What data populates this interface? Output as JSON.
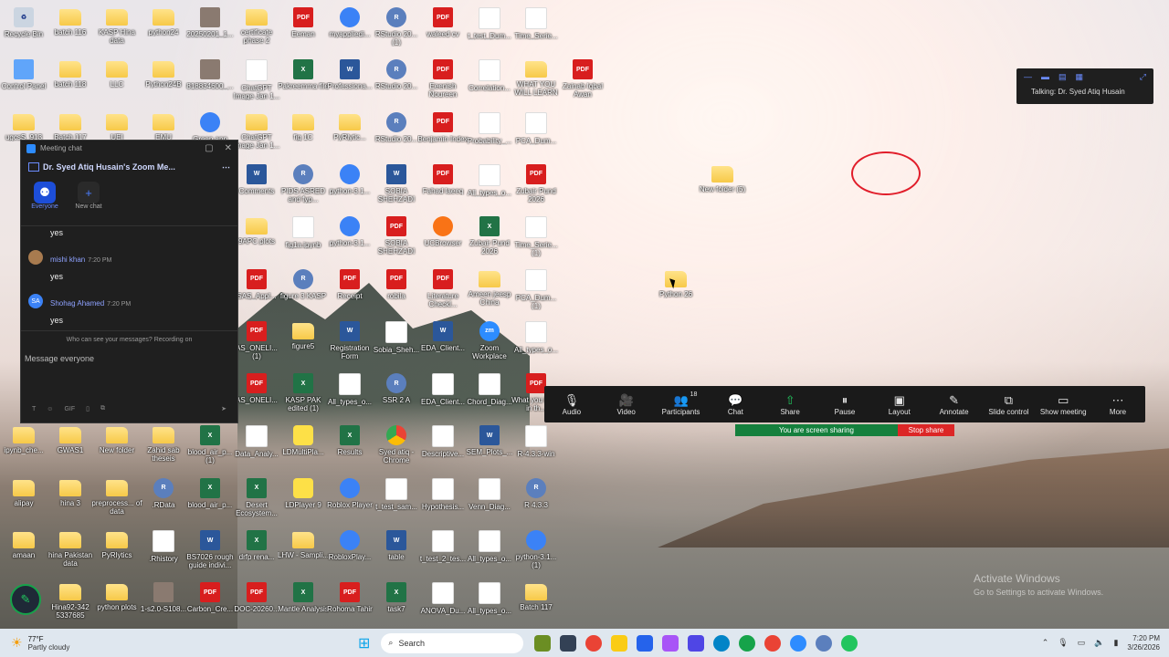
{
  "desktop_icons": [
    {
      "label": "Recycle Bin",
      "type": "recycle",
      "col": 0,
      "row": 0
    },
    {
      "label": "batch 116",
      "type": "folder",
      "col": 1,
      "row": 0
    },
    {
      "label": "KASP Hina data",
      "type": "folder",
      "col": 2,
      "row": 0
    },
    {
      "label": "python24",
      "type": "folder",
      "col": 3,
      "row": 0
    },
    {
      "label": "20250201_1...",
      "type": "img",
      "col": 4,
      "row": 0
    },
    {
      "label": "certificate phase 2",
      "type": "folder",
      "col": 5,
      "row": 0
    },
    {
      "label": "Eeman",
      "type": "pdf",
      "col": 6,
      "row": 0
    },
    {
      "label": "myappliedi...",
      "type": "app",
      "col": 7,
      "row": 0
    },
    {
      "label": "RStudio 20... (1)",
      "type": "r",
      "col": 8,
      "row": 0
    },
    {
      "label": "waleed cv",
      "type": "pdf",
      "col": 9,
      "row": 0
    },
    {
      "label": "t_test_Dum...",
      "type": "file",
      "col": 10,
      "row": 0
    },
    {
      "label": "Time_Serie...",
      "type": "file",
      "col": 11,
      "row": 0
    },
    {
      "label": "Control Panel",
      "type": "cp",
      "col": 0,
      "row": 1
    },
    {
      "label": "batch 118",
      "type": "folder",
      "col": 1,
      "row": 1
    },
    {
      "label": "LLC",
      "type": "folder",
      "col": 2,
      "row": 1
    },
    {
      "label": "Python24B",
      "type": "folder",
      "col": 3,
      "row": 1
    },
    {
      "label": "818834600_...",
      "type": "img",
      "col": 4,
      "row": 1
    },
    {
      "label": "ChatGPT Image Jan 1...",
      "type": "file",
      "col": 5,
      "row": 1
    },
    {
      "label": "Pakreemma file",
      "type": "excel",
      "col": 6,
      "row": 1
    },
    {
      "label": "Professiona...",
      "type": "word",
      "col": 7,
      "row": 1
    },
    {
      "label": "RStudio 20...",
      "type": "r",
      "col": 8,
      "row": 1
    },
    {
      "label": "Eeenish Noureen",
      "type": "pdf",
      "col": 9,
      "row": 1
    },
    {
      "label": "Correlation...",
      "type": "file",
      "col": 10,
      "row": 1
    },
    {
      "label": "WHAT YOU WILL LEARN",
      "type": "folder",
      "col": 11,
      "row": 1
    },
    {
      "label": "Zainab Iqbal Awan",
      "type": "pdf",
      "col": 12,
      "row": 1
    },
    {
      "label": "ugcsS_913",
      "type": "folder",
      "col": 0,
      "row": 2
    },
    {
      "label": "Batch 117",
      "type": "folder",
      "col": 1,
      "row": 2
    },
    {
      "label": "UEI",
      "type": "folder",
      "col": 2,
      "row": 2
    },
    {
      "label": "EMU",
      "type": "folder",
      "col": 3,
      "row": 2
    },
    {
      "label": "Green app",
      "type": "app",
      "col": 4,
      "row": 2
    },
    {
      "label": "ChatGPT Image Jan 1...",
      "type": "folder",
      "col": 5,
      "row": 2
    },
    {
      "label": "fig 1C",
      "type": "folder",
      "col": 6,
      "row": 2
    },
    {
      "label": "PyRlytic...",
      "type": "folder",
      "col": 7,
      "row": 2
    },
    {
      "label": "RStudio 20...",
      "type": "r",
      "col": 8,
      "row": 2
    },
    {
      "label": "Benjamin Index",
      "type": "pdf",
      "col": 9,
      "row": 2
    },
    {
      "label": "Probability_...",
      "type": "file",
      "col": 10,
      "row": 2
    },
    {
      "label": "PCA_Dum...",
      "type": "file",
      "col": 11,
      "row": 2
    },
    {
      "label": "Comments",
      "type": "word",
      "col": 5,
      "row": 3
    },
    {
      "label": "PIDS ASRED and fyp...",
      "type": "r",
      "col": 6,
      "row": 3
    },
    {
      "label": "python-3.1...",
      "type": "app",
      "col": 7,
      "row": 3
    },
    {
      "label": "SOBIA SHEHZADI",
      "type": "word",
      "col": 8,
      "row": 3
    },
    {
      "label": "Fahad laeeq",
      "type": "pdf",
      "col": 9,
      "row": 3
    },
    {
      "label": "All_types_o...",
      "type": "file",
      "col": 10,
      "row": 3
    },
    {
      "label": "Zubair Pund 2026",
      "type": "pdf",
      "col": 11,
      "row": 3
    },
    {
      "label": "New folder (5)",
      "type": "folder",
      "col": 15,
      "row": 3
    },
    {
      "label": "9APC plots",
      "type": "folder",
      "col": 5,
      "row": 4
    },
    {
      "label": "fig1a.ipynb",
      "type": "file",
      "col": 6,
      "row": 4
    },
    {
      "label": "python-3.1...",
      "type": "app",
      "col": 7,
      "row": 4
    },
    {
      "label": "SOBIA SHEHZADI",
      "type": "pdf",
      "col": 8,
      "row": 4
    },
    {
      "label": "UCBrowser",
      "type": "orange",
      "col": 9,
      "row": 4
    },
    {
      "label": "Zubair Pund 2026",
      "type": "excel",
      "col": 10,
      "row": 4
    },
    {
      "label": "Time_Serie... (1)",
      "type": "file",
      "col": 11,
      "row": 4
    },
    {
      "label": "SAS_Appl...",
      "type": "pdf",
      "col": 5,
      "row": 5
    },
    {
      "label": "figure 3 KASP",
      "type": "r",
      "col": 6,
      "row": 5
    },
    {
      "label": "Receipt",
      "type": "pdf",
      "col": 7,
      "row": 5
    },
    {
      "label": "robila",
      "type": "pdf",
      "col": 8,
      "row": 5
    },
    {
      "label": "Literature Checkl...",
      "type": "pdf",
      "col": 9,
      "row": 5
    },
    {
      "label": "Ameen jeesp China",
      "type": "folder",
      "col": 10,
      "row": 5
    },
    {
      "label": "PCA_Dum... (1)",
      "type": "file",
      "col": 11,
      "row": 5
    },
    {
      "label": "Python 26",
      "type": "folder",
      "col": 14,
      "row": 5
    },
    {
      "label": "AS_ONELI... (1)",
      "type": "pdf",
      "col": 5,
      "row": 6
    },
    {
      "label": "figure5",
      "type": "folder",
      "col": 6,
      "row": 6
    },
    {
      "label": "Registration Form",
      "type": "word",
      "col": 7,
      "row": 6
    },
    {
      "label": "Sobia_Sheh...",
      "type": "file",
      "col": 8,
      "row": 6
    },
    {
      "label": "EDA_Client...",
      "type": "word",
      "col": 9,
      "row": 6
    },
    {
      "label": "Zoom Workplace",
      "type": "zoom",
      "col": 10,
      "row": 6
    },
    {
      "label": "All_types_o...",
      "type": "file",
      "col": 11,
      "row": 6
    },
    {
      "label": "AS_ONELI...",
      "type": "pdf",
      "col": 5,
      "row": 7
    },
    {
      "label": "KASP PAK edited (1)",
      "type": "excel",
      "col": 6,
      "row": 7
    },
    {
      "label": "All_types_o...",
      "type": "file",
      "col": 7,
      "row": 7
    },
    {
      "label": "SSR 2 A",
      "type": "r",
      "col": 8,
      "row": 7
    },
    {
      "label": "EDA_Client...",
      "type": "file",
      "col": 9,
      "row": 7
    },
    {
      "label": "Chord_Diag...",
      "type": "file",
      "col": 10,
      "row": 7
    },
    {
      "label": "What you learn in th...",
      "type": "pdf",
      "col": 11,
      "row": 7
    },
    {
      "label": "ipynb_che...",
      "type": "folder",
      "col": 0,
      "row": 8
    },
    {
      "label": "GWAS1",
      "type": "folder",
      "col": 1,
      "row": 8
    },
    {
      "label": "New folder",
      "type": "folder",
      "col": 2,
      "row": 8
    },
    {
      "label": "Zahid sab theseis",
      "type": "folder",
      "col": 3,
      "row": 8
    },
    {
      "label": "blood_air_p... (1)",
      "type": "excel",
      "col": 4,
      "row": 8
    },
    {
      "label": "Data_Analy...",
      "type": "file",
      "col": 5,
      "row": 8
    },
    {
      "label": "LDMultiPla...",
      "type": "yellow",
      "col": 6,
      "row": 8
    },
    {
      "label": "Results",
      "type": "excel",
      "col": 7,
      "row": 8
    },
    {
      "label": "Syed atiq - Chrome",
      "type": "chrome",
      "col": 8,
      "row": 8
    },
    {
      "label": "Descriptive...",
      "type": "file",
      "col": 9,
      "row": 8
    },
    {
      "label": "SEM_Plots_...",
      "type": "word",
      "col": 10,
      "row": 8
    },
    {
      "label": "R-4.3.3-win",
      "type": "file",
      "col": 11,
      "row": 8
    },
    {
      "label": "alipay",
      "type": "folder",
      "col": 0,
      "row": 9
    },
    {
      "label": "hina 3",
      "type": "folder",
      "col": 1,
      "row": 9
    },
    {
      "label": "preprocess... of data",
      "type": "folder",
      "col": 2,
      "row": 9
    },
    {
      "label": ".RData",
      "type": "r",
      "col": 3,
      "row": 9
    },
    {
      "label": "blood_air_p...",
      "type": "excel",
      "col": 4,
      "row": 9
    },
    {
      "label": "Desert Ecosystem...",
      "type": "excel",
      "col": 5,
      "row": 9
    },
    {
      "label": "LDPlayer 9",
      "type": "yellow",
      "col": 6,
      "row": 9
    },
    {
      "label": "Roblox Player",
      "type": "app",
      "col": 7,
      "row": 9
    },
    {
      "label": "t_test_sam...",
      "type": "file",
      "col": 8,
      "row": 9
    },
    {
      "label": "Hypothesis...",
      "type": "file",
      "col": 9,
      "row": 9
    },
    {
      "label": "Venn_Diag...",
      "type": "file",
      "col": 10,
      "row": 9
    },
    {
      "label": "R 4.3.3",
      "type": "r",
      "col": 11,
      "row": 9
    },
    {
      "label": "amaan",
      "type": "folder",
      "col": 0,
      "row": 10
    },
    {
      "label": "hina Pakistan data",
      "type": "folder",
      "col": 1,
      "row": 10
    },
    {
      "label": "PyRlytics",
      "type": "folder",
      "col": 2,
      "row": 10
    },
    {
      "label": ".Rhistory",
      "type": "file",
      "col": 3,
      "row": 10
    },
    {
      "label": "BS7026 rough guide indivi...",
      "type": "word",
      "col": 4,
      "row": 10
    },
    {
      "label": "drfp rena...",
      "type": "excel",
      "col": 5,
      "row": 10
    },
    {
      "label": "LHW - Sampli...",
      "type": "folder",
      "col": 6,
      "row": 10
    },
    {
      "label": "RobloxPlay...",
      "type": "app",
      "col": 7,
      "row": 10
    },
    {
      "label": "table",
      "type": "word",
      "col": 8,
      "row": 10
    },
    {
      "label": "t_test_2_tes...",
      "type": "file",
      "col": 9,
      "row": 10
    },
    {
      "label": "All_types_o...",
      "type": "file",
      "col": 10,
      "row": 10
    },
    {
      "label": "python-3.1... (1)",
      "type": "app",
      "col": 11,
      "row": 10
    },
    {
      "label": "Hina92-342 5337685",
      "type": "folder",
      "col": 1,
      "row": 11
    },
    {
      "label": "python plots",
      "type": "folder",
      "col": 2,
      "row": 11
    },
    {
      "label": "1-s2.0-S108...",
      "type": "img",
      "col": 3,
      "row": 11
    },
    {
      "label": "Carbon_Cre...",
      "type": "pdf",
      "col": 4,
      "row": 11
    },
    {
      "label": "DOC-20260...",
      "type": "pdf",
      "col": 5,
      "row": 11
    },
    {
      "label": "Mantle Analysis",
      "type": "excel",
      "col": 6,
      "row": 11
    },
    {
      "label": "Rohoma Tahir",
      "type": "pdf",
      "col": 7,
      "row": 11
    },
    {
      "label": "task7",
      "type": "excel",
      "col": 8,
      "row": 11
    },
    {
      "label": "ANOVA_Du...",
      "type": "file",
      "col": 9,
      "row": 11
    },
    {
      "label": "All_types_o...",
      "type": "file",
      "col": 10,
      "row": 11
    },
    {
      "label": "Batch 117",
      "type": "folder",
      "col": 11,
      "row": 11
    }
  ],
  "meeting_chat": {
    "window_title": "Meeting chat",
    "chat_title": "Dr. Syed Atiq Husain's Zoom Me...",
    "tabs": [
      {
        "label": "Everyone"
      },
      {
        "label": "New chat"
      }
    ],
    "partial_message": "yes",
    "messages": [
      {
        "name": "mishi khan",
        "time": "7:20 PM",
        "text": "yes",
        "initials": ""
      },
      {
        "name": "Shohag Ahamed",
        "time": "7:20 PM",
        "text": "yes",
        "initials": "SA"
      }
    ],
    "notice": "Who can see your messages? Recording on",
    "input_placeholder": "Message everyone",
    "tool_gif": "GIF"
  },
  "talking_panel": {
    "text": "Talking: Dr. Syed Atiq Husain"
  },
  "zoom_toolbar": {
    "items": [
      {
        "label": "Audio",
        "icon": "microphone-icon",
        "glyph": "🎙"
      },
      {
        "label": "Video",
        "icon": "video-off-icon",
        "glyph": "🎥"
      },
      {
        "label": "Participants",
        "icon": "participants-icon",
        "glyph": "👥",
        "count": "18"
      },
      {
        "label": "Chat",
        "icon": "chat-icon",
        "glyph": "💬"
      },
      {
        "label": "Share",
        "icon": "share-icon",
        "glyph": "⇧"
      },
      {
        "label": "Pause",
        "icon": "pause-icon",
        "glyph": "⏸"
      },
      {
        "label": "Layout",
        "icon": "layout-icon",
        "glyph": "▣"
      },
      {
        "label": "Annotate",
        "icon": "annotate-icon",
        "glyph": "✎"
      },
      {
        "label": "Slide control",
        "icon": "slide-control-icon",
        "glyph": "⧉"
      },
      {
        "label": "Show meeting",
        "icon": "show-meeting-icon",
        "glyph": "▭"
      },
      {
        "label": "More",
        "icon": "more-icon",
        "glyph": "⋯"
      }
    ],
    "share_status": "You are screen sharing",
    "stop_share": "Stop share"
  },
  "watermark": {
    "line1": "Activate Windows",
    "line2": "Go to Settings to activate Windows."
  },
  "taskbar": {
    "weather_temp": "77°F",
    "weather_desc": "Partly cloudy",
    "search_placeholder": "Search",
    "time": "7:20 PM",
    "date": "3/26/2026"
  },
  "colors": {
    "share_green": "#15803d",
    "stop_red": "#dc2626",
    "annotation_red": "#e11d2a",
    "zoom_blue": "#2d8cff"
  }
}
